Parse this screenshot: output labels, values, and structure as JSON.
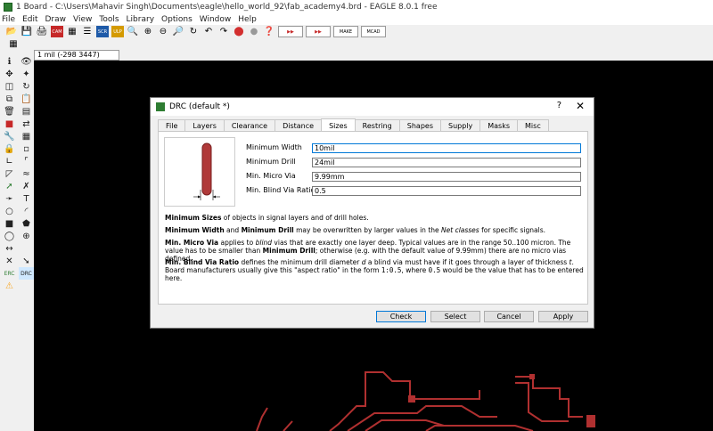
{
  "window": {
    "title": "1 Board - C:\\Users\\Mahavir Singh\\Documents\\eagle\\hello_world_92\\fab_academy4.brd - EAGLE 8.0.1 free"
  },
  "menu": [
    "File",
    "Edit",
    "Draw",
    "View",
    "Tools",
    "Library",
    "Options",
    "Window",
    "Help"
  ],
  "toolbar_labels": {
    "scr": "SCR",
    "ulp": "ULP",
    "cam": "CAM",
    "make": "MAKE",
    "mcad": "MCAD"
  },
  "grid_readout": "1 mil (-298 3447)",
  "sidebar_labels": {
    "erc": "ERC",
    "drc": "DRC"
  },
  "dialog": {
    "title": "DRC (default *)",
    "help": "?",
    "close": "✕",
    "tabs": [
      "File",
      "Layers",
      "Clearance",
      "Distance",
      "Sizes",
      "Restring",
      "Shapes",
      "Supply",
      "Masks",
      "Misc"
    ],
    "active_tab": "Sizes",
    "fields": [
      {
        "label": "Minimum Width",
        "value": "10mil"
      },
      {
        "label": "Minimum Drill",
        "value": "24mil"
      },
      {
        "label": "Min. Micro Via",
        "value": "9.99mm"
      },
      {
        "label": "Min. Blind Via Ratio",
        "value": "0.5"
      }
    ],
    "desc": {
      "p1_b": "Minimum Sizes",
      "p1_t": " of objects in signal layers and of drill holes.",
      "p2_b1": "Minimum Width",
      "p2_t1": " and ",
      "p2_b2": "Minimum Drill",
      "p2_t2": " may be overwritten by larger values in the ",
      "p2_i": "Net classes",
      "p2_t3": " for specific signals.",
      "p3_b1": "Min. Micro Via",
      "p3_t1": " applies to ",
      "p3_i": "blind",
      "p3_t2": " vias that are exactly one layer deep. Typical values are in the range 50..100 micron. The value has to be smaller than ",
      "p3_b2": "Minimum Drill",
      "p3_t3": "; otherwise (e.g. with the default value of 9.99mm) there are no micro vias defined.",
      "p4_b": "Min. Blind Via Ratio",
      "p4_t1": " defines the minimum drill diameter ",
      "p4_i1": "d",
      "p4_t2": " a blind via must have if it goes through a layer of thickness ",
      "p4_i2": "t",
      "p4_t3": ". Board manufacturers usually give this \"aspect ratio\" in the form ",
      "p4_m1": "1:0.5",
      "p4_t4": ", where ",
      "p4_m2": "0.5",
      "p4_t5": " would be the value that has to be entered here."
    },
    "buttons": {
      "check": "Check",
      "select": "Select",
      "cancel": "Cancel",
      "apply": "Apply"
    }
  },
  "colors": {
    "trace": "#b03030",
    "accent": "#0078d7"
  }
}
